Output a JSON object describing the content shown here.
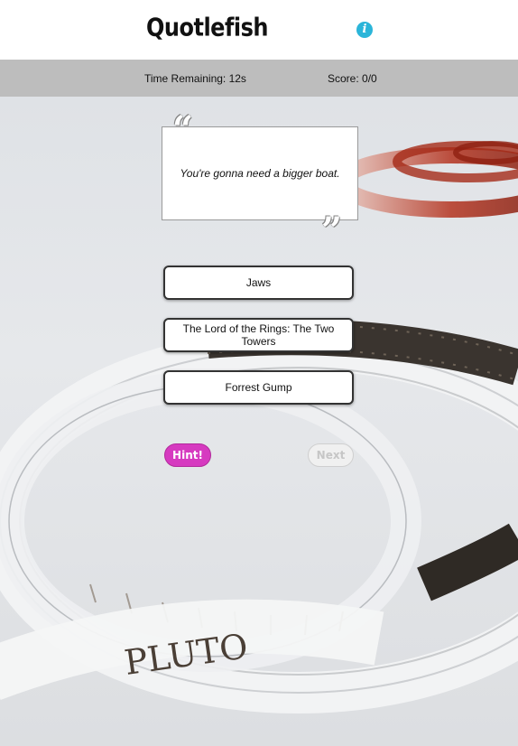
{
  "header": {
    "logo_text": "Quotlefish",
    "info_icon": "info-icon",
    "info_glyph": "i",
    "accent_color": "#2bb5d9"
  },
  "status": {
    "time_remaining": "Time Remaining: 12s",
    "score": "Score: 0/0"
  },
  "quote": {
    "text": "You're gonna need a bigger boat.",
    "open_mark": "“",
    "close_mark": "”"
  },
  "answers": [
    {
      "label": "Jaws"
    },
    {
      "label": "The Lord of the Rings: The Two Towers"
    },
    {
      "label": "Forrest Gump"
    }
  ],
  "actions": {
    "hint_label": "Hint!",
    "next_label": "Next",
    "hint_color": "#d63ac0",
    "next_enabled": false
  },
  "background": {
    "film_reel_text": "PLUTO"
  }
}
